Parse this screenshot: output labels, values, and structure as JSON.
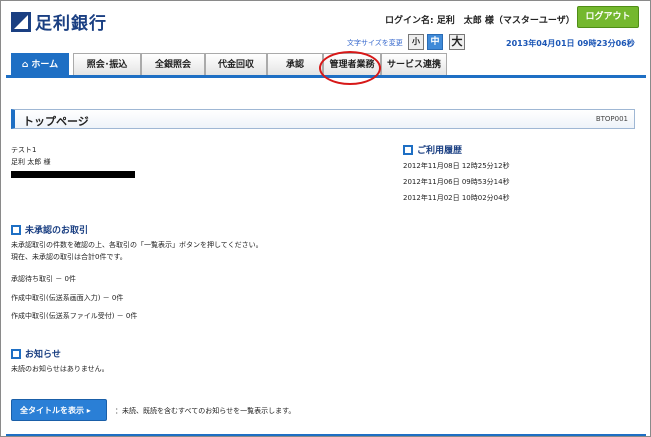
{
  "header": {
    "bank_name": "足利銀行",
    "login_label": "ログイン名:",
    "login_user": "足利　太郎 様（マスターユーザ）",
    "logout_label": "ログアウト",
    "fontsize_label": "文字サイズを変更",
    "fontsize_small": "小",
    "fontsize_medium": "中",
    "fontsize_large": "大",
    "datetime": "2013年04月01日 09時23分06秒"
  },
  "nav": {
    "tabs": [
      {
        "label": "⌂ ホーム"
      },
      {
        "label": "照会･振込"
      },
      {
        "label": "全銀照会"
      },
      {
        "label": "代金回収"
      },
      {
        "label": "承認"
      },
      {
        "label": "管理者業務"
      },
      {
        "label": "サービス連携"
      }
    ]
  },
  "page": {
    "title": "トップページ",
    "code": "BTOP001"
  },
  "user": {
    "company": "テスト1",
    "name": "足利 太郎 様"
  },
  "history": {
    "title": "ご利用履歴",
    "entries": [
      "2012年11月08日 12時25分12秒",
      "2012年11月06日 09時53分14秒",
      "2012年11月02日 10時02分04秒"
    ]
  },
  "pending": {
    "title": "未承認のお取引",
    "desc1": "未承認取引の件数を確認の上、各取引の「一覧表示」ボタンを押してください。",
    "desc2": "現在、未承認の取引は合計0件です。",
    "items": [
      "承認待ち取引 － 0件",
      "作成中取引(伝送系画面入力) － 0件",
      "作成中取引(伝送系ファイル受付) － 0件"
    ]
  },
  "notice": {
    "title": "お知らせ",
    "text": "未読のお知らせはありません。",
    "all_button": "全タイトルを表示 ▸",
    "all_desc": "：未読、既読を含むすべてのお知らせを一覧表示します。"
  },
  "colors": {
    "accent": "#1e6fc4",
    "logout": "#74b82e",
    "highlight_circle": "#d71818"
  }
}
